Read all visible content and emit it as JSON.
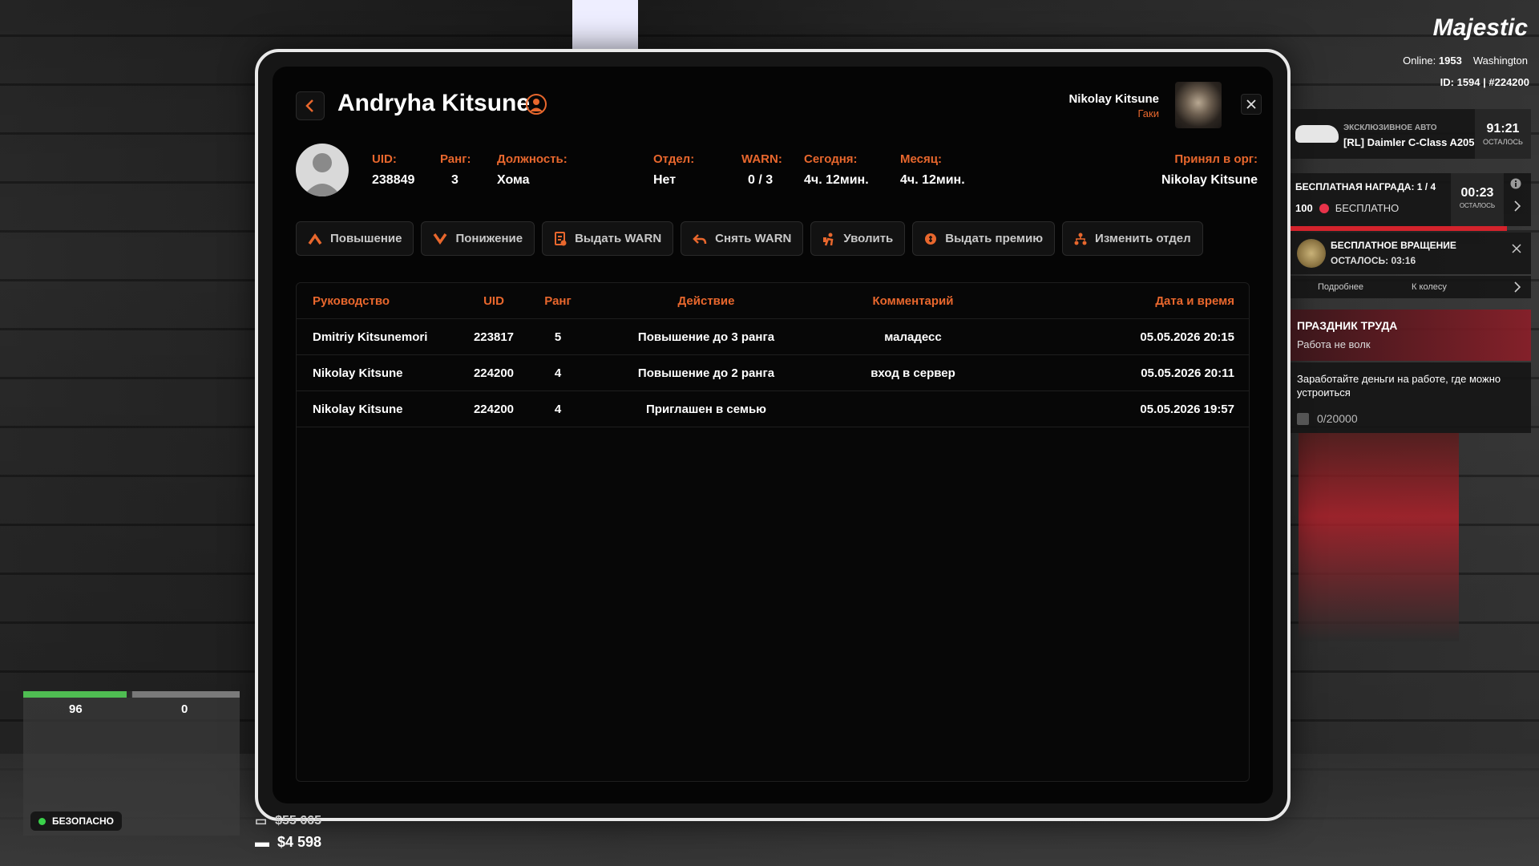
{
  "member": {
    "name": "Andryha Kitsune",
    "fields": [
      {
        "label": "UID:",
        "value": "238849"
      },
      {
        "label": "Ранг:",
        "value": "3"
      },
      {
        "label": "Должность:",
        "value": "Хома"
      },
      {
        "label": "Отдел:",
        "value": "Нет"
      },
      {
        "label": "WARN:",
        "value": "0 / 3"
      },
      {
        "label": "Сегодня:",
        "value": "4ч. 12мин."
      },
      {
        "label": "Месяц:",
        "value": "4ч. 12мин."
      },
      {
        "label": "Принял в орг:",
        "value": "Nikolay Kitsune"
      }
    ]
  },
  "viewer": {
    "name": "Nikolay Kitsune",
    "org": "Гаки"
  },
  "actions": [
    {
      "label": "Повышение",
      "icon": "chevron-up-icon"
    },
    {
      "label": "Понижение",
      "icon": "chevron-down-icon"
    },
    {
      "label": "Выдать WARN",
      "icon": "warn-doc-icon"
    },
    {
      "label": "Снять WARN",
      "icon": "undo-icon"
    },
    {
      "label": "Уволить",
      "icon": "fire-person-icon"
    },
    {
      "label": "Выдать премию",
      "icon": "coin-icon"
    },
    {
      "label": "Изменить отдел",
      "icon": "hierarchy-icon"
    }
  ],
  "log_table": {
    "headers": [
      "Руководство",
      "UID",
      "Ранг",
      "Действие",
      "Комментарий",
      "Дата и время"
    ],
    "rows": [
      [
        "Dmitriy Kitsunemori",
        "223817",
        "5",
        "Повышение до 3 ранга",
        "маладесс",
        "05.05.2026 20:15"
      ],
      [
        "Nikolay Kitsune",
        "224200",
        "4",
        "Повышение до 2 ранга",
        "вход в сервер",
        "05.05.2026 20:11"
      ],
      [
        "Nikolay Kitsune",
        "224200",
        "4",
        "Приглашен в семью",
        "",
        "05.05.2026 19:57"
      ]
    ]
  },
  "hud": {
    "logo": "Majestic",
    "online_label": "Online:",
    "online_value": "1953",
    "server": "Washington",
    "id_line": "ID: 1594 | #224200",
    "car_tag": "ЭКСКЛЮЗИВНОЕ АВТО",
    "car_name": "[RL] Daimler C-Class A205",
    "car_timer": "91:21",
    "car_timer_sub": "ОСТАЛОСЬ",
    "reward_title": "БЕСПЛАТНАЯ НАГРАДА: 1 / 4",
    "reward_amount": "100",
    "reward_free": "БЕСПЛАТНО",
    "reward_timer": "00:23",
    "reward_timer_sub": "ОСТАЛОСЬ",
    "spin_title": "БЕСПЛАТНОЕ ВРАЩЕНИЕ",
    "spin_left": "ОСТАЛОСЬ: 03:16",
    "spin_more": "Подробнее",
    "spin_wheel": "К колесу",
    "event_title": "ПРАЗДНИК ТРУДА",
    "event_sub": "Работа не волк",
    "task_text": "Заработайте деньги на работе, где можно устроиться",
    "task_progress": "0/20000",
    "health": 96,
    "health_fraction": 0.96,
    "armor": 0,
    "safe_label": "БЕЗОПАСНО",
    "bank_amount": "$55 665",
    "cash_amount": "$4 598"
  },
  "colors": {
    "accent": "#e8672d",
    "safe": "#3ad14a",
    "health": "#4fbd52"
  }
}
